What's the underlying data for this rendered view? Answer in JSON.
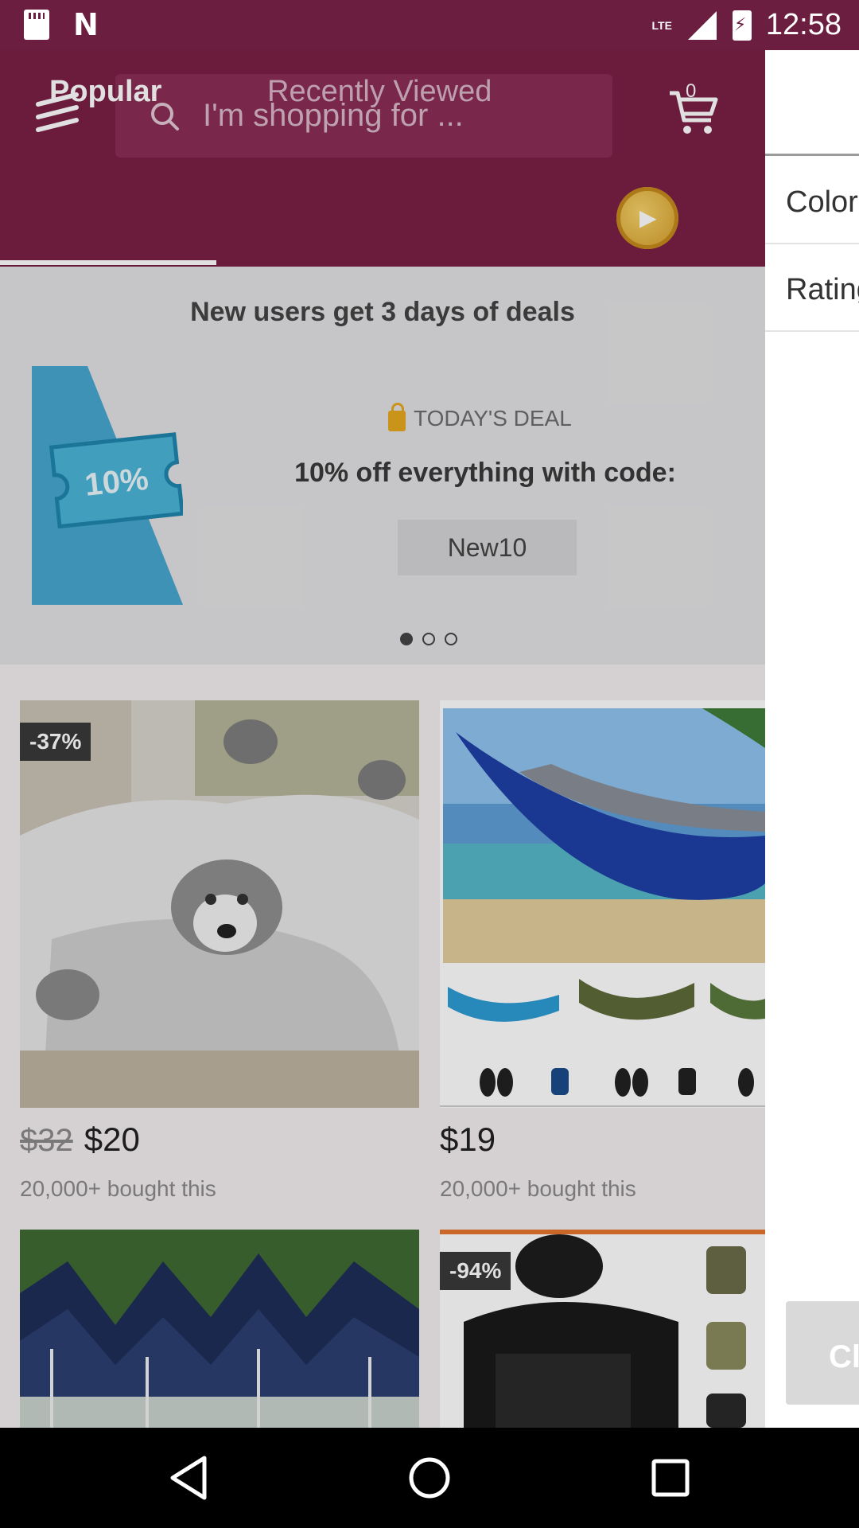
{
  "status_bar": {
    "network": "LTE",
    "time": "12:58",
    "icons": [
      "sd-card-icon",
      "n-notification-icon",
      "signal-icon",
      "battery-charging-icon"
    ]
  },
  "header": {
    "search_placeholder": "I'm shopping for ...",
    "cart_count": "0",
    "icons": [
      "menu-icon",
      "search-icon",
      "cart-icon",
      "coin-play-icon"
    ]
  },
  "tabs": [
    {
      "label": "Popular",
      "active": true
    },
    {
      "label": "Recently Viewed",
      "active": false
    }
  ],
  "banner": {
    "title": "New users get 3 days of deals",
    "ticket_text": "10%",
    "deal_label": "TODAY'S DEAL",
    "deal_text": "10% off everything with code:",
    "code": "New10",
    "page_index": 1,
    "page_count": 3
  },
  "products": [
    {
      "badge": "-37%",
      "old_price": "$32",
      "price": "$20",
      "sold": "20,000+ bought this"
    },
    {
      "badge": "",
      "old_price": "",
      "price": "$19",
      "sold": "20,000+ bought this"
    },
    {
      "badge": "",
      "old_price": "",
      "price": "",
      "sold": ""
    },
    {
      "badge": "-94%",
      "old_price": "",
      "price": "",
      "sold": ""
    }
  ],
  "drawer": {
    "items": [
      "Color",
      "Rating"
    ],
    "button_label": "Cl"
  },
  "colors": {
    "brand": "#7a1f45",
    "status_bar": "#6b1e3f",
    "banner_bg": "#e2e2e4"
  },
  "nav": {
    "icons": [
      "back-icon",
      "home-icon",
      "recents-icon"
    ]
  }
}
